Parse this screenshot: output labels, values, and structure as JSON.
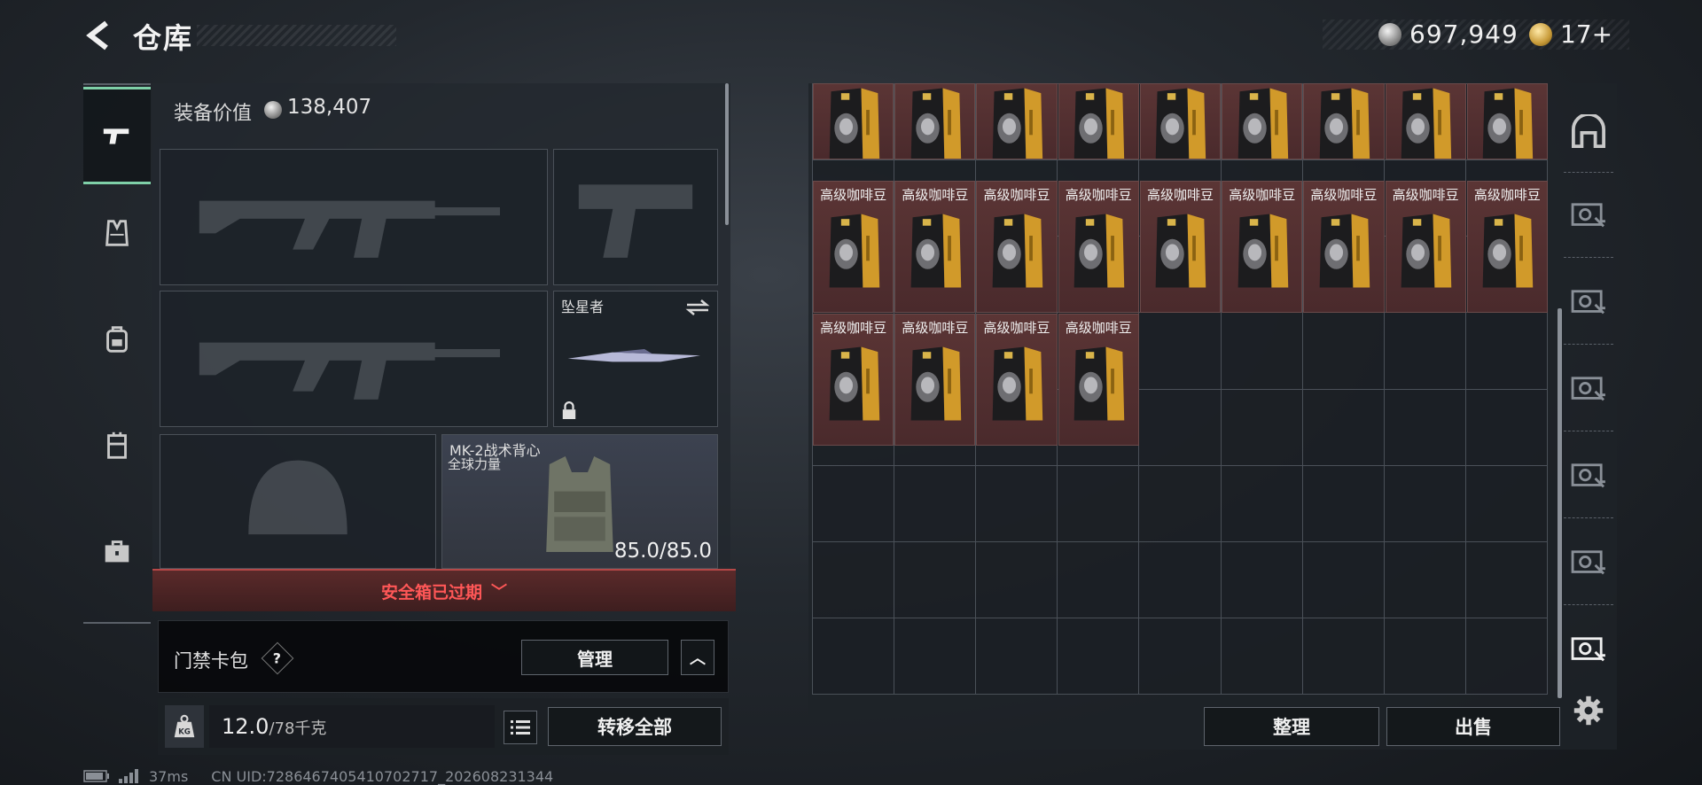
{
  "header": {
    "title": "仓库",
    "back_icon": "back-arrow-icon"
  },
  "currency": {
    "silver_value": "697,949",
    "gold_value": "17+"
  },
  "side_tabs": [
    {
      "name": "weapons",
      "icon": "pistol-icon",
      "active": true
    },
    {
      "name": "armor",
      "icon": "vest-icon",
      "active": false
    },
    {
      "name": "backpack",
      "icon": "backpack-icon",
      "active": false
    },
    {
      "name": "rig",
      "icon": "chest-rig-icon",
      "active": false
    },
    {
      "name": "case",
      "icon": "briefcase-icon",
      "active": false
    }
  ],
  "equipment": {
    "value_label": "装备价值",
    "value": "138,407",
    "melee_name": "坠星者",
    "vest_name": "MK-2战术背心",
    "vest_subtitle": "全球力量",
    "vest_durability": "85.0/85.0"
  },
  "safebox": {
    "label": "安全箱已过期",
    "chevron": "﹀"
  },
  "keycard": {
    "label": "门禁卡包",
    "help": "?",
    "manage_label": "管理",
    "collapse": "︿"
  },
  "weight": {
    "icon": "KG",
    "current": "12.0",
    "max": "/78千克",
    "transfer_label": "转移全部"
  },
  "storage": {
    "item_name": "高级咖啡豆",
    "row1_count": 9,
    "row2_count": 9,
    "row3_count": 4,
    "sort_label": "整理",
    "sell_label": "出售"
  },
  "status": {
    "ping": "37ms",
    "uid": "CN UID:7286467405410702717_202608231344"
  },
  "colors": {
    "accent_green": "#7fd0a8",
    "warning_red": "#ff5757",
    "item_bg": "#4f2e30"
  }
}
